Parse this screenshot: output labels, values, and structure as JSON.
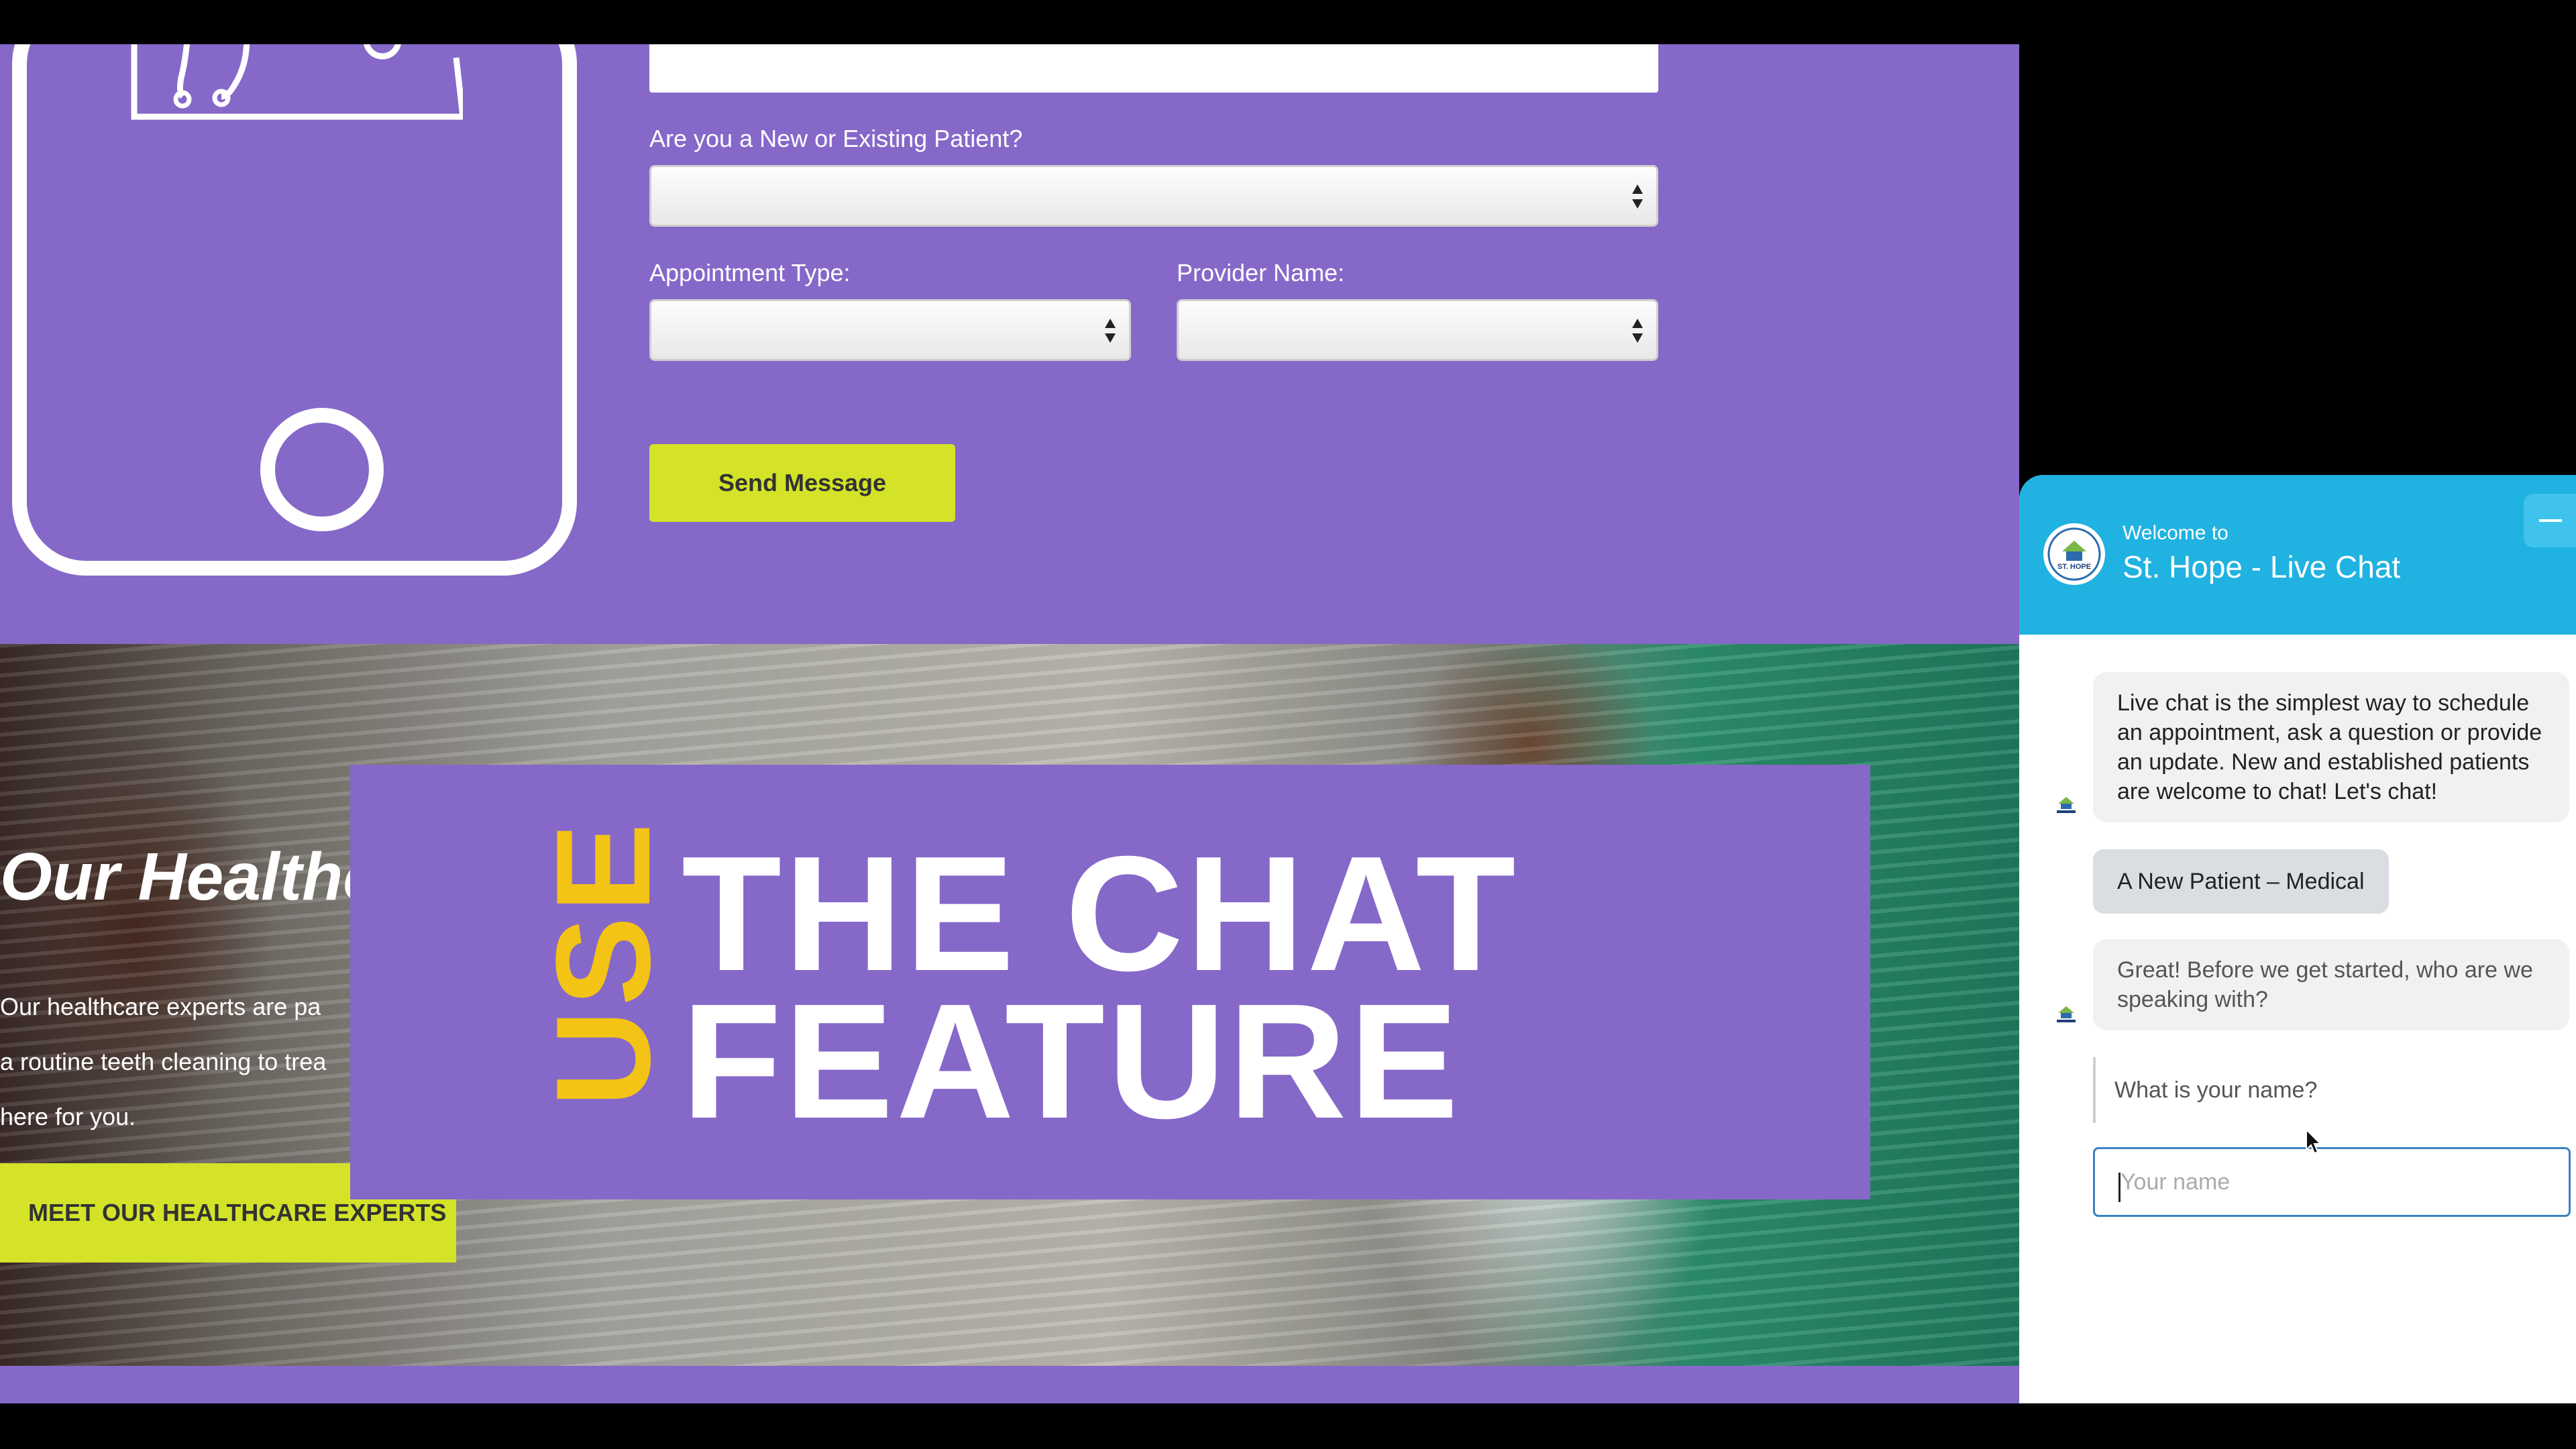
{
  "form": {
    "patient_label": "Are you a New or Existing Patient?",
    "appointment_label": "Appointment Type:",
    "provider_label": "Provider Name:",
    "send_label": "Send Message"
  },
  "hero": {
    "heading": "Our Healthc",
    "text_lines": [
      "Our healthcare experts are pa",
      "a routine teeth cleaning to trea",
      "here for you."
    ],
    "button_label": "MEET OUR HEALTHCARE EXPERTS"
  },
  "banner": {
    "side_word": "USE",
    "line1": "THE CHAT",
    "line2": "FEATURE"
  },
  "chat": {
    "welcome": "Welcome to",
    "title": "St. Hope - Live Chat",
    "logo_text": "ST. HOPE",
    "intro_message": "Live chat is the simplest way to schedule an appointment, ask a question or provide an update. New and established patients are welcome to chat! Let's chat!",
    "selected_option": "A New Patient – Medical",
    "followup_message": "Great! Before we get started, who are we speaking with?",
    "name_prompt": "What is your name?",
    "name_placeholder": "Your name"
  },
  "colors": {
    "page_purple": "#8668c9",
    "accent_lime": "#d4e327",
    "accent_yellow": "#f3c316",
    "chat_blue": "#20b2e0",
    "input_border_blue": "#3b82c4"
  },
  "icons": [
    "doctor-stethoscope-icon",
    "select-arrows-icon",
    "minimize-icon",
    "st-hope-logo-icon",
    "mouse-pointer-icon"
  ]
}
